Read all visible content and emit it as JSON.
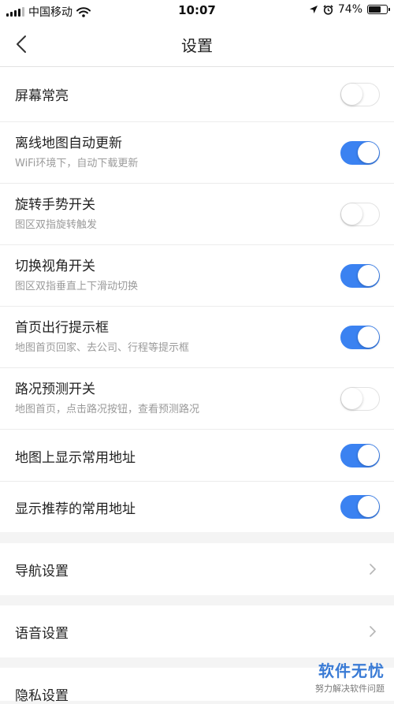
{
  "status_bar": {
    "carrier": "中国移动",
    "time": "10:07",
    "battery_percent": "74%",
    "battery_level": 0.74,
    "icons": [
      "signal-icon",
      "wifi-icon",
      "location-arrow-icon",
      "alarm-icon",
      "battery-icon"
    ]
  },
  "header": {
    "title": "设置",
    "back_icon": "chevron-left-icon"
  },
  "toggle_items": [
    {
      "title": "屏幕常亮",
      "subtitle": "",
      "on": false
    },
    {
      "title": "离线地图自动更新",
      "subtitle": "WiFi环境下，自动下载更新",
      "on": true
    },
    {
      "title": "旋转手势开关",
      "subtitle": "图区双指旋转触发",
      "on": false
    },
    {
      "title": "切换视角开关",
      "subtitle": "图区双指垂直上下滑动切换",
      "on": true
    },
    {
      "title": "首页出行提示框",
      "subtitle": "地图首页回家、去公司、行程等提示框",
      "on": true
    },
    {
      "title": "路况预测开关",
      "subtitle": "地图首页，点击路况按钮，查看预测路况",
      "on": false
    },
    {
      "title": "地图上显示常用地址",
      "subtitle": "",
      "on": true
    },
    {
      "title": "显示推荐的常用地址",
      "subtitle": "",
      "on": true
    }
  ],
  "nav_items": [
    {
      "title": "导航设置"
    },
    {
      "title": "语音设置"
    },
    {
      "title": "隐私设置"
    }
  ],
  "watermark": {
    "main": "软件无忧",
    "sub": "努力解决软件问题"
  },
  "colors": {
    "accent": "#3b82f1",
    "background": "#f4f4f4",
    "subtitle": "#9a9a9a"
  }
}
